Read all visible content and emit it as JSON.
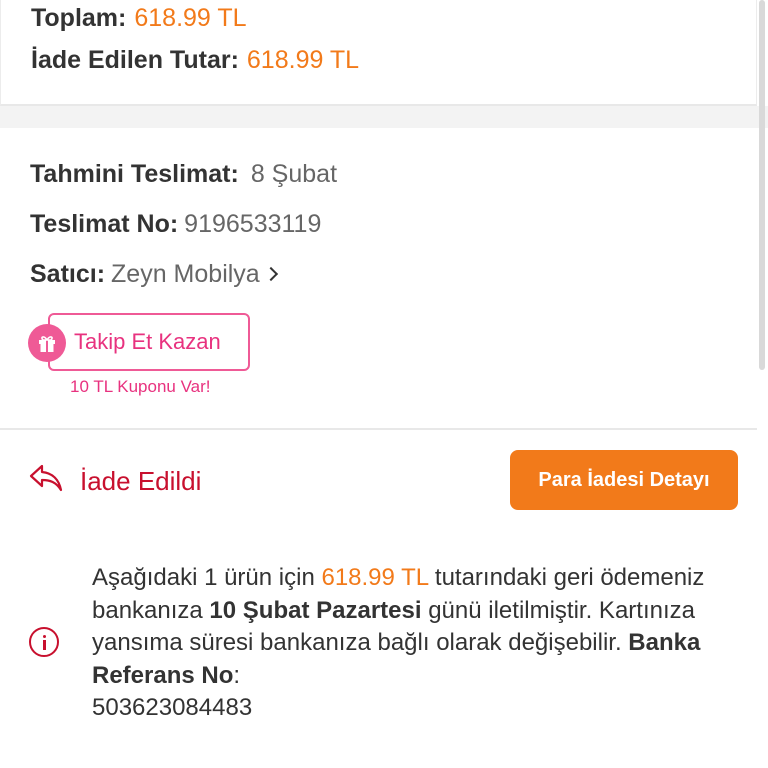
{
  "summary": {
    "total_label": "Toplam:",
    "total_value": "618.99 TL",
    "refunded_label": "İade Edilen Tutar:",
    "refunded_value": "618.99 TL"
  },
  "delivery": {
    "eta_label": "Tahmini Teslimat:",
    "eta_value": "8 Şubat",
    "delivery_no_label": "Teslimat No:",
    "delivery_no_value": "9196533119",
    "seller_label": "Satıcı:",
    "seller_value": "Zeyn Mobilya",
    "follow_button": "Takip Et Kazan",
    "coupon_note": "10 TL Kuponu Var!"
  },
  "return": {
    "status": "İade Edildi",
    "detail_button": "Para İadesi Detayı"
  },
  "refund_message": {
    "part1": "Aşağıdaki 1 ürün için ",
    "amount": "618.99 TL",
    "part2": " tutarındaki geri ödemeniz bankanıza ",
    "date": "10 Şubat Pazartesi",
    "part3": " günü iletilmiştir. Kartınıza yansıma süresi bankanıza bağlı olarak değişebilir. ",
    "ref_label": "Banka Referans No",
    "colon": ":",
    "ref_no": "503623084483"
  },
  "colors": {
    "accent_orange": "#f27a1a",
    "status_red": "#c8102e",
    "promo_pink": "#ef5a96"
  },
  "icons": [
    "gift-icon",
    "chevron-right-icon",
    "return-arrow-icon",
    "info-icon"
  ]
}
